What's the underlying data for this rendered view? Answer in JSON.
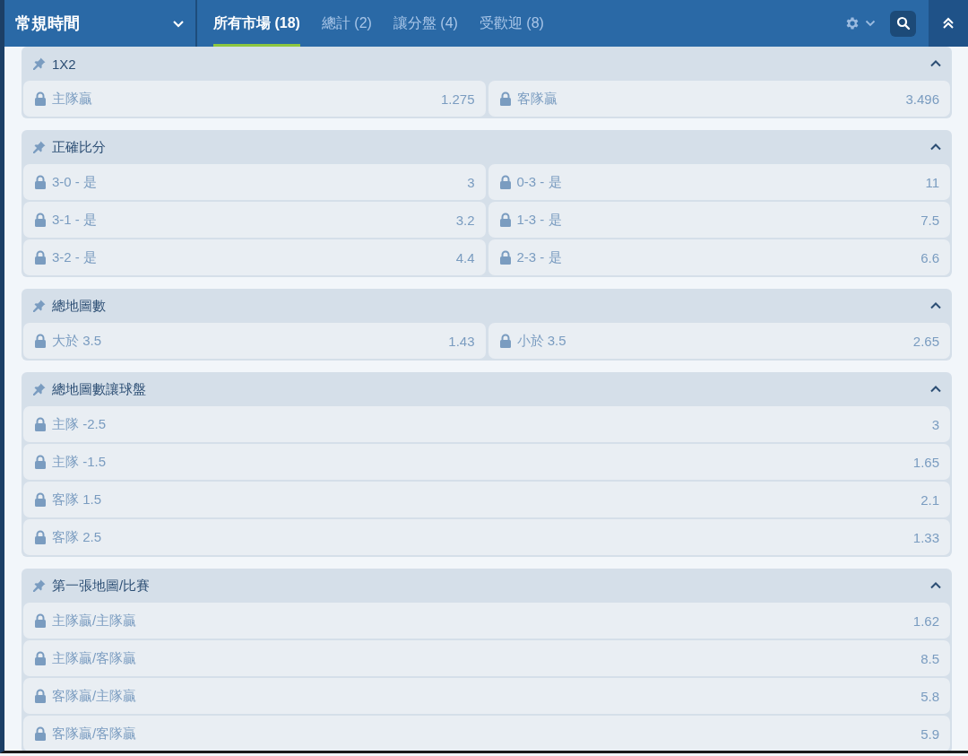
{
  "period_select": {
    "label": "常規時間"
  },
  "tabs": [
    {
      "label": "所有市場 (18)",
      "selected": true
    },
    {
      "label": "總計 (2)",
      "selected": false
    },
    {
      "label": "讓分盤 (4)",
      "selected": false
    },
    {
      "label": "受歡迎 (8)",
      "selected": false
    }
  ],
  "markets": [
    {
      "title": "1X2",
      "expanded": true,
      "kind": "pairs",
      "outcomes": [
        {
          "label": "主隊贏",
          "odds": "1.275",
          "locked": true
        },
        {
          "label": "客隊贏",
          "odds": "3.496",
          "locked": true
        }
      ]
    },
    {
      "title": "正確比分",
      "expanded": true,
      "kind": "pairs",
      "outcomes": [
        {
          "label": "3-0 - 是",
          "odds": "3",
          "locked": true
        },
        {
          "label": "0-3 - 是",
          "odds": "11",
          "locked": true
        },
        {
          "label": "3-1 - 是",
          "odds": "3.2",
          "locked": true
        },
        {
          "label": "1-3 - 是",
          "odds": "7.5",
          "locked": true
        },
        {
          "label": "3-2 - 是",
          "odds": "4.4",
          "locked": true
        },
        {
          "label": "2-3 - 是",
          "odds": "6.6",
          "locked": true
        }
      ]
    },
    {
      "title": "總地圖數",
      "expanded": true,
      "kind": "pairs",
      "outcomes": [
        {
          "label": "大於 3.5",
          "odds": "1.43",
          "locked": true
        },
        {
          "label": "小於 3.5",
          "odds": "2.65",
          "locked": true
        }
      ]
    },
    {
      "title": "總地圖數讓球盤",
      "expanded": true,
      "kind": "list",
      "outcomes": [
        {
          "label": "主隊 -2.5",
          "odds": "3",
          "locked": true
        },
        {
          "label": "主隊 -1.5",
          "odds": "1.65",
          "locked": true
        },
        {
          "label": "客隊 1.5",
          "odds": "2.1",
          "locked": true
        },
        {
          "label": "客隊 2.5",
          "odds": "1.33",
          "locked": true
        }
      ]
    },
    {
      "title": "第一張地圖/比賽",
      "expanded": true,
      "kind": "list",
      "outcomes": [
        {
          "label": "主隊贏/主隊贏",
          "odds": "1.62",
          "locked": true
        },
        {
          "label": "主隊贏/客隊贏",
          "odds": "8.5",
          "locked": true
        },
        {
          "label": "客隊贏/主隊贏",
          "odds": "5.8",
          "locked": true
        },
        {
          "label": "客隊贏/客隊贏",
          "odds": "5.9",
          "locked": true
        }
      ]
    }
  ]
}
